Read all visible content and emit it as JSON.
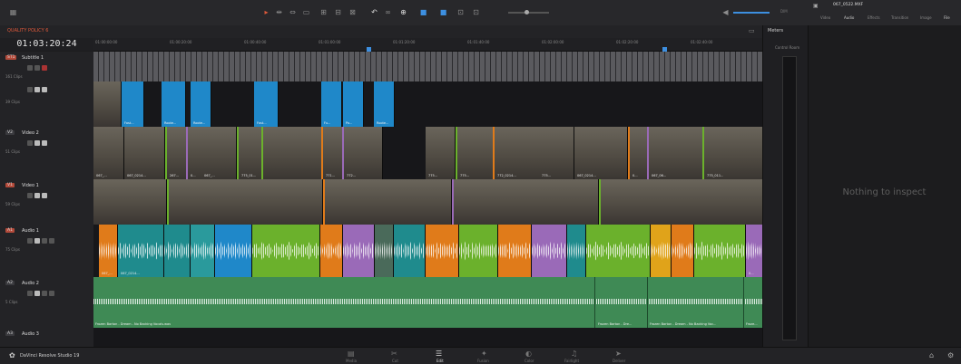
{
  "toolbar": {
    "timeline_name": "QUALITY POLICY 6",
    "volume_readout": "DIM",
    "icons": [
      "pointer-icon",
      "trim-icon",
      "dynamic-trim-icon",
      "blade-icon",
      "insert-icon",
      "overwrite-icon",
      "replace-icon",
      "snapping-icon",
      "link-icon",
      "lock-icon",
      "flag-icon",
      "marker-icon",
      "zoom-icon"
    ]
  },
  "timeline": {
    "timecode": "01:03:20:24",
    "ruler_ticks": [
      "01:00:00:00",
      "01:00:20:00",
      "01:00:40:00",
      "01:01:00:00",
      "01:01:20:00",
      "01:01:40:00",
      "01:02:00:00",
      "01:02:20:00",
      "01:02:40:00"
    ]
  },
  "tracks": [
    {
      "tag": "ST1",
      "name": "Subtitle 1",
      "clips": "161 Clips"
    },
    {
      "tag": "",
      "name": "",
      "clips": "39 Clips"
    },
    {
      "tag": "V2",
      "name": "Video 2",
      "clips": "51 Clips"
    },
    {
      "tag": "V1",
      "name": "Video 1",
      "clips": "59 Clips"
    },
    {
      "tag": "A1",
      "name": "Audio 1",
      "clips": "75 Clips"
    },
    {
      "tag": "A2",
      "name": "Audio 2",
      "clips": "5 Clips"
    },
    {
      "tag": "A3",
      "name": "Audio 3",
      "clips": ""
    }
  ],
  "clip_labels": {
    "top": [
      "Fost...",
      "Roote...",
      "Roote...",
      "Fost...",
      "Fu...",
      "Po...",
      "Roote..."
    ],
    "v2": [
      "067_...",
      "067_0214...",
      "267...",
      "0...",
      "067_...",
      "775_01...",
      "771...",
      "772...",
      "775...",
      "775...",
      "772_0214...",
      "775...",
      "067_0214...",
      "0...",
      "067_06...",
      "775_011..."
    ],
    "a1": [
      "067_...",
      "067_0214...",
      "0..."
    ],
    "a2_left": "Frozen Barton - Dream - No Backing Vocals.wav",
    "a2_mid": "Frozen Barton - Dre...",
    "a2_right": "Frozen Barton - Dream - No Backing Voc...",
    "a2_end": "Froze..."
  },
  "meters": {
    "title": "Meters",
    "sub": "Control Room"
  },
  "inspector": {
    "file": "067_0522.MXF",
    "tabs": [
      "Video",
      "Audio",
      "Effects",
      "Transition",
      "Image",
      "File"
    ],
    "empty_message": "Nothing to inspect"
  },
  "bottom": {
    "app_name": "DaVinci Resolve Studio 19",
    "pages": [
      "Media",
      "Cut",
      "Edit",
      "Fusion",
      "Color",
      "Fairlight",
      "Deliver"
    ]
  },
  "colors": {
    "accent_blue": "#1f88c9",
    "green_clip": "#6bb12c",
    "orange_clip": "#e07b1a",
    "purple_clip": "#9a6ab8",
    "teal_clip": "#1f8b8d",
    "audio2_green": "#3f8a55"
  }
}
